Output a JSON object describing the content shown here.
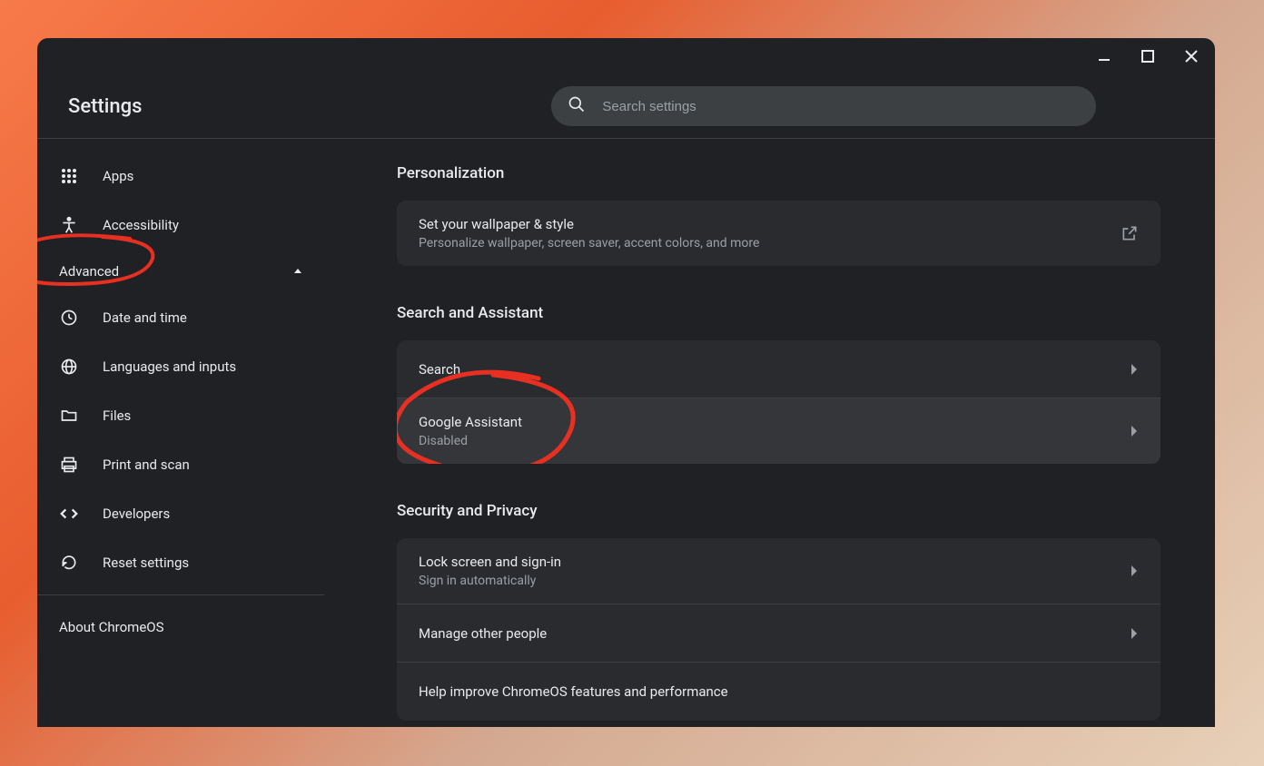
{
  "app": {
    "title": "Settings"
  },
  "search": {
    "placeholder": "Search settings"
  },
  "sidebar": {
    "items": [
      {
        "icon": "apps",
        "label": "Apps"
      },
      {
        "icon": "accessibility",
        "label": "Accessibility"
      }
    ],
    "section_header": "Advanced",
    "advanced_items": [
      {
        "icon": "clock",
        "label": "Date and time"
      },
      {
        "icon": "globe",
        "label": "Languages and inputs"
      },
      {
        "icon": "folder",
        "label": "Files"
      },
      {
        "icon": "print",
        "label": "Print and scan"
      },
      {
        "icon": "code",
        "label": "Developers"
      },
      {
        "icon": "reset",
        "label": "Reset settings"
      }
    ],
    "about": "About ChromeOS"
  },
  "main": {
    "sections": [
      {
        "title": "Personalization",
        "rows": [
          {
            "title": "Set your wallpaper & style",
            "sub": "Personalize wallpaper, screen saver, accent colors, and more",
            "trail": "external"
          }
        ]
      },
      {
        "title": "Search and Assistant",
        "rows": [
          {
            "title": "Search",
            "sub": "",
            "trail": "arrow"
          },
          {
            "title": "Google Assistant",
            "sub": "Disabled",
            "trail": "arrow",
            "highlighted": true
          }
        ]
      },
      {
        "title": "Security and Privacy",
        "rows": [
          {
            "title": "Lock screen and sign-in",
            "sub": "Sign in automatically",
            "trail": "arrow"
          },
          {
            "title": "Manage other people",
            "sub": "",
            "trail": "arrow"
          },
          {
            "title": "Help improve ChromeOS features and performance",
            "sub": "",
            "trail": "toggle"
          }
        ]
      }
    ]
  },
  "annotations": {
    "color": "#e83022"
  }
}
